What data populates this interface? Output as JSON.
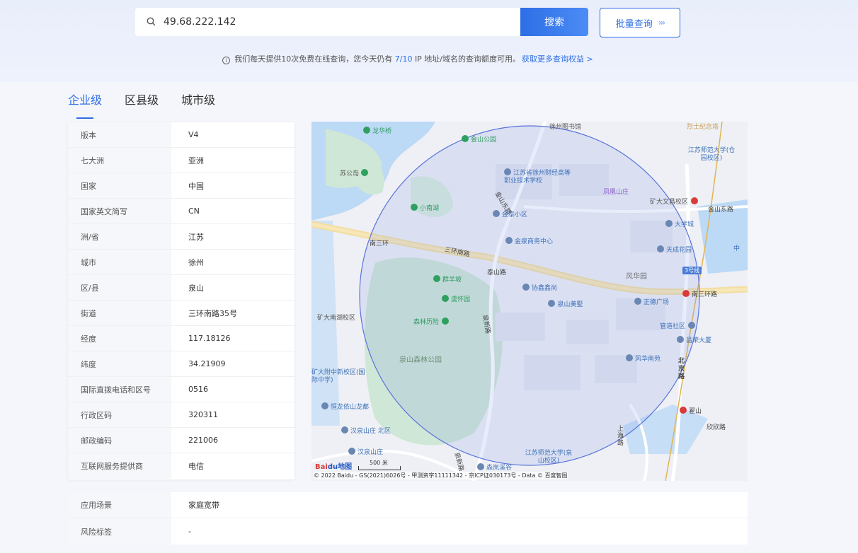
{
  "search": {
    "value": "49.68.222.142",
    "button_label": "搜索",
    "batch_label": "批量查询",
    "batch_arrows": "›››"
  },
  "notice": {
    "prefix": "我们每天提供10次免费在线查询，您今天仍有",
    "quota": "7/10",
    "suffix": "IP 地址/域名的查询额度可用。",
    "link": "获取更多查询权益 >"
  },
  "tabs": [
    {
      "label": "企业级"
    },
    {
      "label": "区县级"
    },
    {
      "label": "城市级"
    }
  ],
  "info_rows": [
    {
      "key": "版本",
      "value": "V4"
    },
    {
      "key": "七大洲",
      "value": "亚洲"
    },
    {
      "key": "国家",
      "value": "中国"
    },
    {
      "key": "国家英文简写",
      "value": "CN"
    },
    {
      "key": "洲/省",
      "value": "江苏"
    },
    {
      "key": "城市",
      "value": "徐州"
    },
    {
      "key": "区/县",
      "value": "泉山"
    },
    {
      "key": "街道",
      "value": "三环南路35号"
    },
    {
      "key": "经度",
      "value": "117.18126"
    },
    {
      "key": "纬度",
      "value": "34.21909"
    },
    {
      "key": "国际直拨电话和区号",
      "value": "0516"
    },
    {
      "key": "行政区码",
      "value": "320311"
    },
    {
      "key": "邮政编码",
      "value": "221006"
    },
    {
      "key": "互联网服务提供商",
      "value": "电信"
    }
  ],
  "extra_rows": [
    {
      "key": "应用场景",
      "value": "家庭宽带"
    },
    {
      "key": "风险标签",
      "value": "-"
    }
  ],
  "map": {
    "labels": {
      "longhuaqiao": "龙华桥",
      "jinshanpark": "金山公园",
      "library": "徐州图书馆",
      "monument": "烈士纪念塔",
      "jsnu_gulou": "江苏师范大学(仓园校区)",
      "sudao": "苏公岛",
      "caijing": "江苏省徐州财经高等职业技术学校",
      "jinshandonglu": "金山东路",
      "fenghuangshanzhuang": "凤凰山庄",
      "kuangda_wenchang": "矿大文昌校区",
      "jinshanlu": "金山东路",
      "xiaonanhu": "小南湖",
      "jintai": "金泰小区",
      "daxuecheng": "大学城",
      "nansanhuan_left": "南三环",
      "sanhuannanlu": "三环南路",
      "jinquan": "金泉商务中心",
      "tianchenghuayuan": "天成花园",
      "taishanlu": "泰山路",
      "fenghuayuan": "风华园",
      "qunyangpo": "群羊坡",
      "xiesen": "协鑫鑫尚",
      "line3": "3号线",
      "nansanhuanlu_right": "南三环路",
      "kuangda_nanhu": "矿大南湖校区",
      "huaiyuan": "虞怀园",
      "zhengde": "正德广场",
      "senlinlishi": "森林历险",
      "quanshanmeishu": "泉山美墅",
      "quanxinlu": "泉新路",
      "guanzhishequ": "管道社区",
      "jinyi": "昌荣大厦",
      "park_big": "泉山森林公园",
      "fenghuananyuan": "风华南苑",
      "beijinglu": "北京路",
      "kuangda_fuzhong": "矿大附中新校区(国际中学)",
      "henglong": "恒龙依山龙都",
      "yushan": "翟山",
      "hanquan_north": "汉泉山庄 北区",
      "xinxinlu": "欣欣路",
      "shanghailu": "上海路",
      "hanquan": "汉泉山庄",
      "jsnu_quanshan": "江苏师范大学(泉山校区)",
      "quanxinlu2": "泉新路",
      "senlan": "森岚溪谷",
      "zhong": "中"
    },
    "scale": "500 米",
    "logo_bai": "Bai",
    "logo_du": "du地图",
    "copyright": "© 2022 Baidu - GS(2021)6026号 - 甲测资字11111342 - 京ICP证030173号 - Data © 百度智图"
  }
}
